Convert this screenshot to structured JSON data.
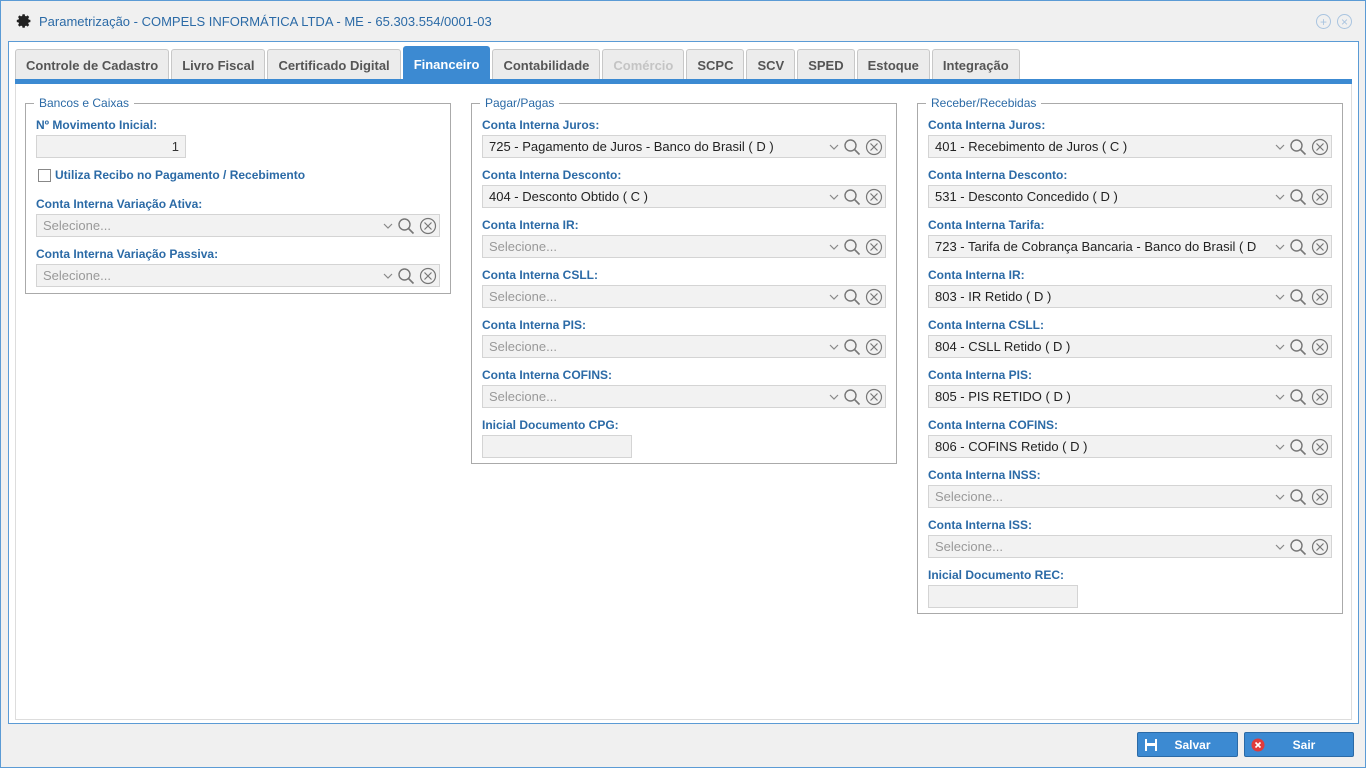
{
  "window": {
    "title": "Parametrização - COMPELS INFORMÁTICA LTDA - ME - 65.303.554/0001-03"
  },
  "tabs": [
    {
      "label": "Controle de Cadastro",
      "state": "normal"
    },
    {
      "label": "Livro Fiscal",
      "state": "normal"
    },
    {
      "label": "Certificado Digital",
      "state": "normal"
    },
    {
      "label": "Financeiro",
      "state": "active"
    },
    {
      "label": "Contabilidade",
      "state": "normal"
    },
    {
      "label": "Comércio",
      "state": "disabled"
    },
    {
      "label": "SCPC",
      "state": "normal"
    },
    {
      "label": "SCV",
      "state": "normal"
    },
    {
      "label": "SPED",
      "state": "normal"
    },
    {
      "label": "Estoque",
      "state": "normal"
    },
    {
      "label": "Integração",
      "state": "normal"
    }
  ],
  "bancos": {
    "legend": "Bancos e Caixas",
    "movimento_label": "Nº Movimento Inicial:",
    "movimento_value": "1",
    "recibo_label": "Utiliza Recibo no Pagamento / Recebimento",
    "recibo_checked": false,
    "var_ativa_label": "Conta Interna Variação Ativa:",
    "var_ativa_value": "Selecione...",
    "var_passiva_label": "Conta Interna Variação Passiva:",
    "var_passiva_value": "Selecione..."
  },
  "pagar": {
    "legend": "Pagar/Pagas",
    "fields": [
      {
        "label": "Conta Interna Juros:",
        "value": "725 - Pagamento de Juros - Banco do Brasil ( D )",
        "placeholder": false
      },
      {
        "label": "Conta Interna Desconto:",
        "value": "404 - Desconto Obtido ( C )",
        "placeholder": false
      },
      {
        "label": "Conta Interna IR:",
        "value": "Selecione...",
        "placeholder": true
      },
      {
        "label": "Conta Interna CSLL:",
        "value": "Selecione...",
        "placeholder": true
      },
      {
        "label": "Conta Interna PIS:",
        "value": "Selecione...",
        "placeholder": true
      },
      {
        "label": "Conta Interna COFINS:",
        "value": "Selecione...",
        "placeholder": true
      }
    ],
    "doc_label": "Inicial Documento CPG:",
    "doc_value": ""
  },
  "receber": {
    "legend": "Receber/Recebidas",
    "fields": [
      {
        "label": "Conta Interna Juros:",
        "value": "401 - Recebimento de Juros ( C )",
        "placeholder": false
      },
      {
        "label": "Conta Interna Desconto:",
        "value": "531 - Desconto Concedido ( D )",
        "placeholder": false
      },
      {
        "label": "Conta Interna Tarifa:",
        "value": "723 - Tarifa de Cobrança Bancaria - Banco do Brasil ( D",
        "placeholder": false
      },
      {
        "label": "Conta Interna IR:",
        "value": "803 - IR Retido ( D )",
        "placeholder": false
      },
      {
        "label": "Conta Interna CSLL:",
        "value": "804 - CSLL Retido ( D )",
        "placeholder": false
      },
      {
        "label": "Conta Interna PIS:",
        "value": "805 - PIS RETIDO ( D )",
        "placeholder": false
      },
      {
        "label": "Conta Interna COFINS:",
        "value": "806 - COFINS Retido ( D )",
        "placeholder": false
      },
      {
        "label": "Conta Interna INSS:",
        "value": "Selecione...",
        "placeholder": true
      },
      {
        "label": "Conta Interna ISS:",
        "value": "Selecione...",
        "placeholder": true
      }
    ],
    "doc_label": "Inicial Documento REC:",
    "doc_value": ""
  },
  "buttons": {
    "save": "Salvar",
    "exit": "Sair"
  },
  "colors": {
    "accent": "#3c8ad2",
    "label": "#2b6aa6",
    "exit_icon": "#e03b3b"
  }
}
